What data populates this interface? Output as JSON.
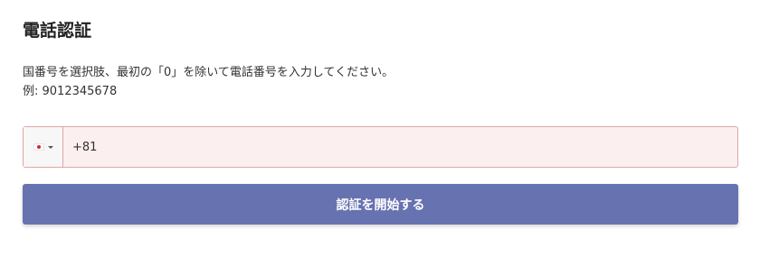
{
  "page": {
    "title": "電話認証"
  },
  "instructions": {
    "line1": "国番号を選択肢、最初の「0」を除いて電話番号を入力してください。",
    "line2": "例: 9012345678"
  },
  "phone": {
    "country_flag": "jp-flag-icon",
    "value": "+81",
    "placeholder": ""
  },
  "submit": {
    "label": "認証を開始する"
  },
  "colors": {
    "accent": "#6772b0",
    "input_error_border": "#e0a6a6",
    "input_error_bg": "#fbefef"
  }
}
